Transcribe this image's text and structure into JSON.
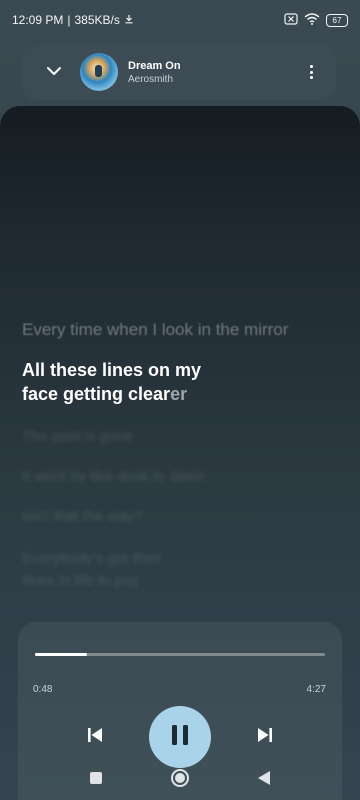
{
  "status_bar": {
    "time": "12:09 PM",
    "speed": "385KB/s",
    "battery": "67"
  },
  "now_playing": {
    "title": "Dream On",
    "artist": "Aerosmith"
  },
  "lyrics": {
    "previous": "Every time when I look in the mirror",
    "current_line1": "All these lines on my",
    "current_line2_sung": "face getting clear",
    "current_line2_rest": "er",
    "upcoming": [
      "The past is gone",
      "It went by like dusk to dawn",
      "Isn't that the way?",
      "Everybody's got their",
      "dues in life to pay"
    ]
  },
  "player": {
    "progress": 0.18,
    "elapsed": "0:48",
    "total": "4:27"
  },
  "colors": {
    "accent": "#a9d3e8",
    "background": "#33424a"
  },
  "icons": {
    "collapse": "chevron-down-icon",
    "more": "more-vert-icon",
    "previous": "skip-previous-icon",
    "pause": "pause-icon",
    "next": "skip-next-icon"
  }
}
